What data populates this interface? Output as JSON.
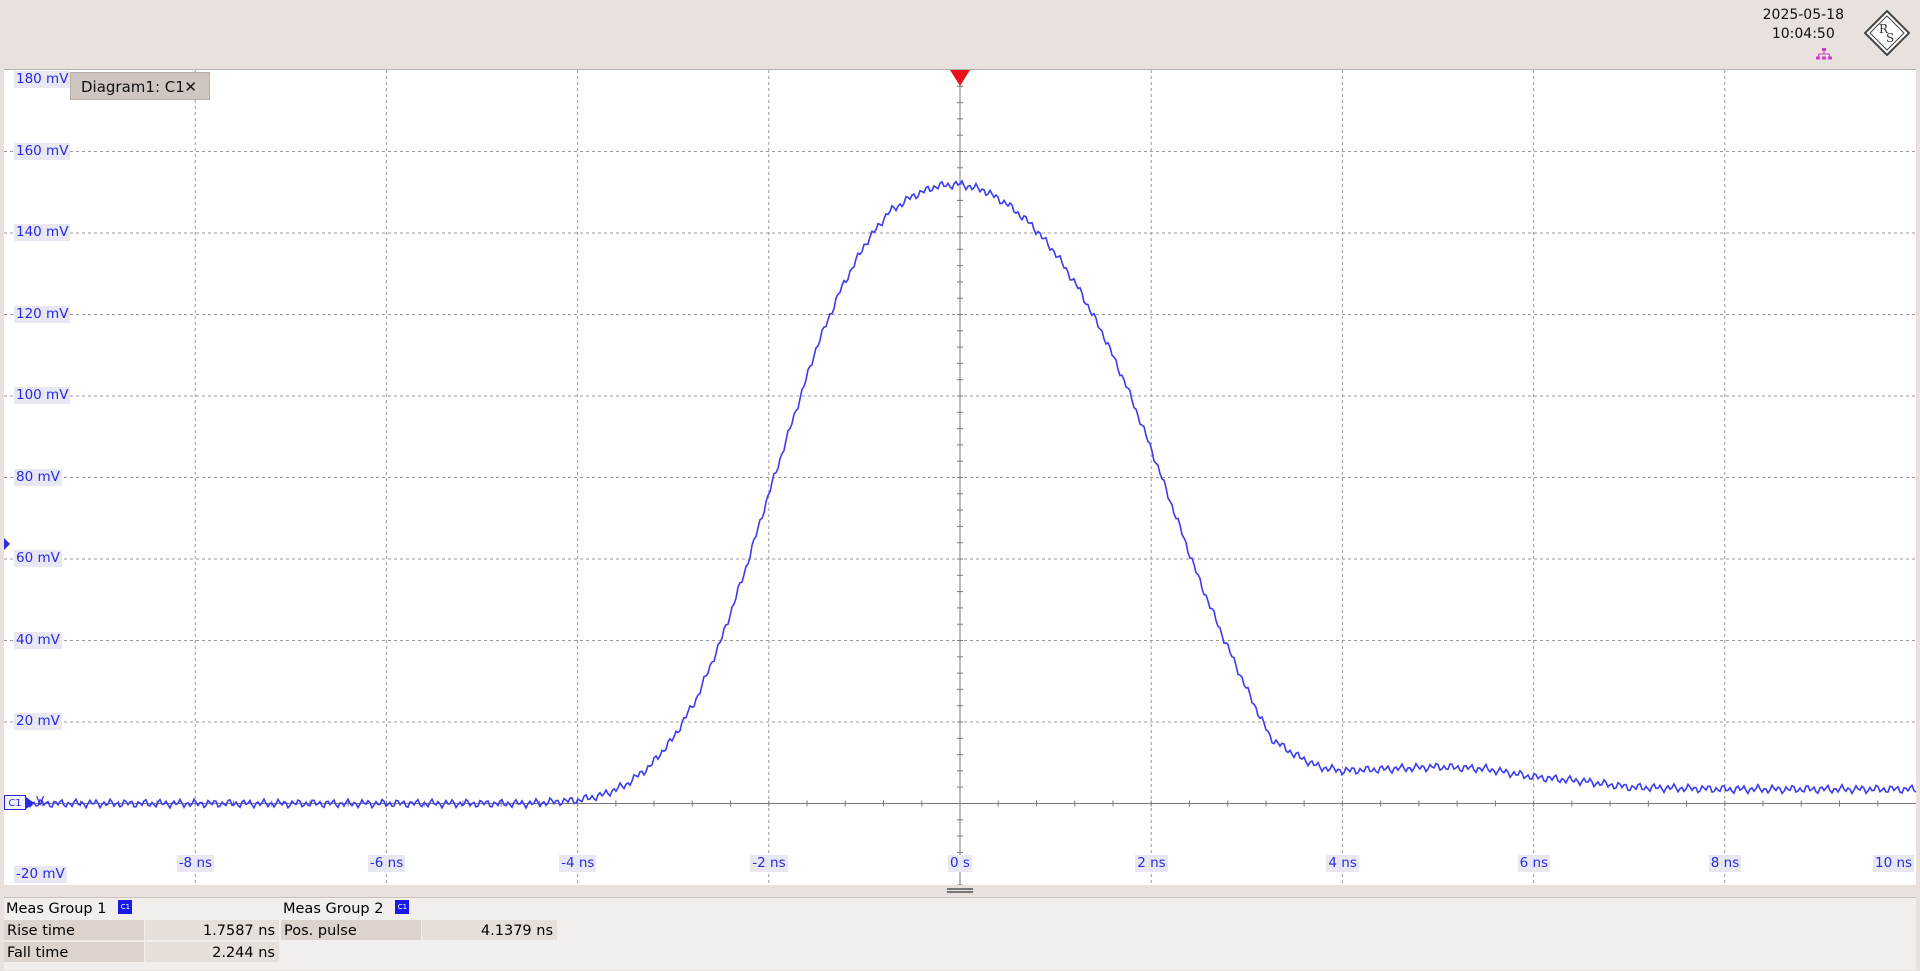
{
  "header": {
    "date": "2025-05-18",
    "time": "10:04:50",
    "logo_text": "RS",
    "network_icon": "network-icon"
  },
  "diagram": {
    "tab_label": "Diagram1: C1",
    "close_label": "✕",
    "channel_label": "C1",
    "channel_unit": "V"
  },
  "chart_data": {
    "type": "line",
    "xlabel": "",
    "ylabel": "",
    "x_unit": "ns",
    "y_unit": "mV",
    "xlim": [
      -10,
      10
    ],
    "ylim": [
      -20,
      180
    ],
    "x_ticks": [
      "-8 ns",
      "-6 ns",
      "-4 ns",
      "-2 ns",
      "0 s",
      "2 ns",
      "4 ns",
      "6 ns",
      "8 ns",
      "10 ns"
    ],
    "y_ticks": [
      "180 mV",
      "160 mV",
      "140 mV",
      "120 mV",
      "100 mV",
      "80 mV",
      "60 mV",
      "40 mV",
      "20 mV",
      "-20 mV"
    ],
    "grid": true,
    "trigger_position": 0,
    "color": "#3b3bf0",
    "series": [
      {
        "x": [
          -10,
          -9,
          -8,
          -7,
          -6,
          -5,
          -4.5,
          -4,
          -3.75,
          -3.5,
          -3.25,
          -3,
          -2.75,
          -2.5,
          -2.25,
          -2,
          -1.75,
          -1.5,
          -1.25,
          -1,
          -0.75,
          -0.5,
          -0.25,
          0,
          0.25,
          0.5,
          0.75,
          1,
          1.25,
          1.5,
          1.75,
          2,
          2.25,
          2.5,
          2.75,
          3,
          3.25,
          3.5,
          3.75,
          4,
          4.5,
          5,
          5.5,
          6,
          6.5,
          7,
          8,
          9,
          10
        ],
        "y": [
          0,
          0,
          0,
          0,
          0,
          0,
          0,
          0.8,
          2,
          4.5,
          9,
          16,
          26,
          40,
          57,
          76,
          94,
          112,
          126,
          137,
          145,
          149,
          151.5,
          152,
          150.5,
          147,
          142,
          135,
          126,
          115,
          102,
          87,
          71,
          55,
          41,
          28,
          16,
          12,
          9,
          8,
          8.5,
          9,
          8.5,
          6.5,
          5.5,
          4,
          3.5,
          3.5,
          3.5
        ]
      }
    ]
  },
  "measurements": {
    "groups": [
      {
        "title": "Meas Group 1",
        "badge": "C1",
        "rows": [
          {
            "name": "Rise time",
            "value": "1.7587 ns"
          },
          {
            "name": "Fall time",
            "value": "2.244 ns"
          }
        ]
      },
      {
        "title": "Meas Group 2",
        "badge": "C1",
        "rows": [
          {
            "name": "Pos. pulse",
            "value": "4.1379 ns"
          }
        ]
      }
    ]
  }
}
